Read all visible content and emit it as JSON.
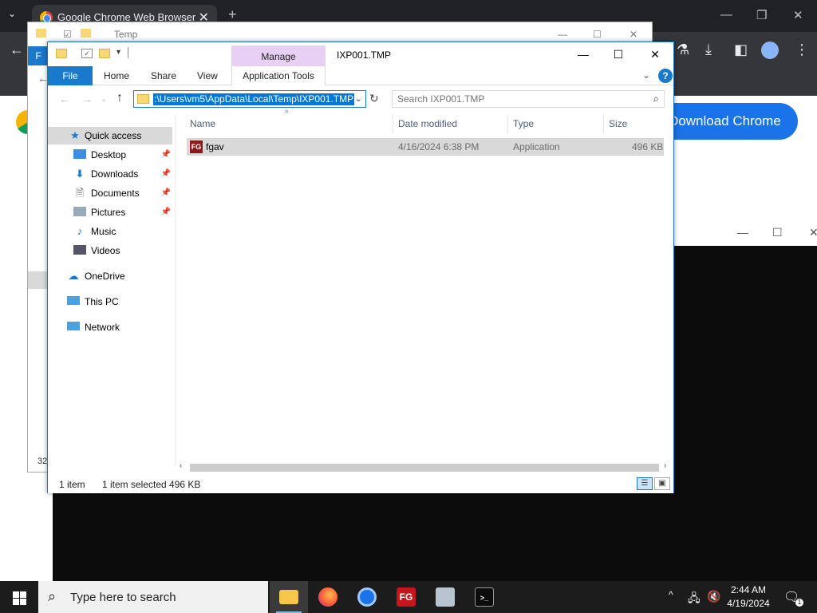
{
  "chrome": {
    "tab_title": "Google Chrome Web Browser",
    "tab_close": "✕",
    "new_tab": "+",
    "download_button": "Download Chrome"
  },
  "back_explorer": {
    "title": "Temp",
    "file_tab_partial": "F",
    "status_partial": "32"
  },
  "explorer": {
    "title": "IXP001.TMP",
    "context_tab_group": "Manage",
    "ribbon_tabs": {
      "file": "File",
      "home": "Home",
      "share": "Share",
      "view": "View",
      "application_tools": "Application Tools"
    },
    "address_path": ":\\Users\\vm5\\AppData\\Local\\Temp\\IXP001.TMP",
    "search_placeholder": "Search IXP001.TMP",
    "nav": {
      "quick_access": "Quick access",
      "desktop": "Desktop",
      "downloads": "Downloads",
      "documents": "Documents",
      "pictures": "Pictures",
      "music": "Music",
      "videos": "Videos",
      "onedrive": "OneDrive",
      "this_pc": "This PC",
      "network": "Network"
    },
    "columns": {
      "name": "Name",
      "date_modified": "Date modified",
      "type": "Type",
      "size": "Size"
    },
    "files": [
      {
        "name": "fgav",
        "date_modified": "4/16/2024 6:38 PM",
        "type": "Application",
        "size": "496 KB",
        "icon_text": "FG"
      }
    ],
    "status": {
      "item_count": "1 item",
      "selection": "1 item selected  496 KB"
    }
  },
  "taskbar": {
    "search_placeholder": "Type here to search",
    "fg_app_label": "FG",
    "clock_time": "2:44 AM",
    "clock_date": "4/19/2024",
    "notification_count": "1"
  },
  "colors": {
    "accent": "#1979ca",
    "selection": "#0078d7",
    "manage_tab": "#e8d0f5",
    "chrome_button": "#1a73e8"
  }
}
